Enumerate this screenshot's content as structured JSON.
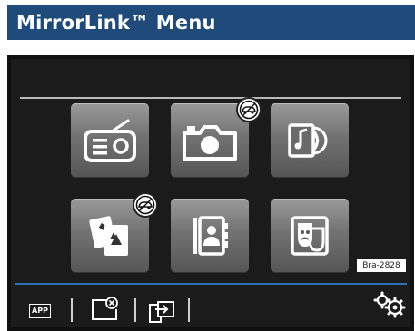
{
  "header": {
    "title": "MirrorLink™ Menu"
  },
  "colors": {
    "header_bg": "#1f4a7a",
    "screen_bg": "#1b1b1b",
    "accent_line": "#2e6fb6",
    "tile_gray": "#7a7a7a"
  },
  "tiles": [
    {
      "icon": "radio-icon"
    },
    {
      "icon": "camera-icon",
      "badge": "driving-restricted-icon"
    },
    {
      "icon": "media-icon"
    },
    {
      "icon": "cards-game-icon",
      "badge": "driving-restricted-icon"
    },
    {
      "icon": "contacts-icon"
    },
    {
      "icon": "theater-icon"
    }
  ],
  "bottom_bar": {
    "app_label": "APP",
    "items": [
      "close-app-icon",
      "switch-app-icon",
      "settings-icon"
    ]
  },
  "figure_ref": "Bra-2828"
}
